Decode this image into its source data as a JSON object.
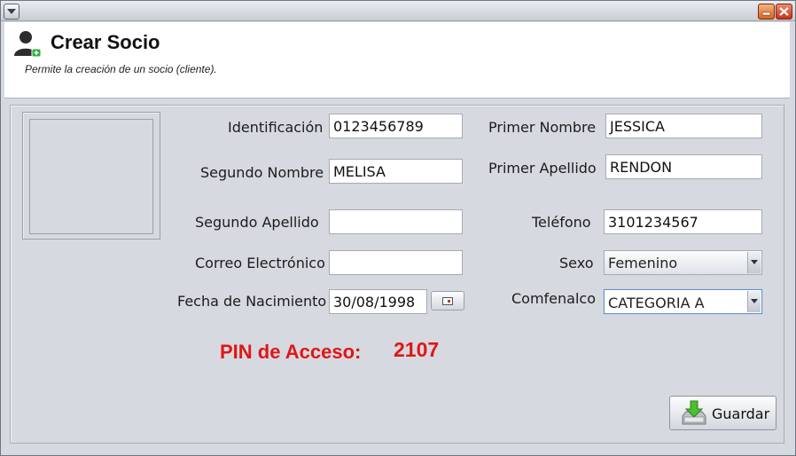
{
  "header": {
    "title": "Crear Socio",
    "subtitle": "Permite la creación de un socio (cliente)."
  },
  "form": {
    "identificacion": {
      "label": "Identificación",
      "value": "0123456789"
    },
    "primer_nombre": {
      "label": "Primer Nombre",
      "value": "JESSICA"
    },
    "segundo_nombre": {
      "label": "Segundo Nombre",
      "value": "MELISA"
    },
    "primer_apellido": {
      "label": "Primer Apellido",
      "value": "RENDON"
    },
    "segundo_apellido": {
      "label": "Segundo Apellido",
      "value": ""
    },
    "telefono": {
      "label": "Teléfono",
      "value": "3101234567"
    },
    "correo": {
      "label": "Correo Electrónico",
      "value": ""
    },
    "sexo": {
      "label": "Sexo",
      "value": "Femenino"
    },
    "fecha_nacimiento": {
      "label": "Fecha de Nacimiento",
      "value": "30/08/1998"
    },
    "comfenalco": {
      "label": "Comfenalco",
      "value": "CATEGORIA A"
    }
  },
  "pin": {
    "label": "PIN de Acceso:",
    "value": "2107",
    "color": "#e01616"
  },
  "actions": {
    "save_label": "Guardar"
  },
  "icons": {
    "header": "add-user-icon",
    "window_menu": "chevron-down-icon",
    "minimize": "minimize-icon",
    "close": "close-icon",
    "calendar": "calendar-icon",
    "save": "save-download-icon"
  }
}
